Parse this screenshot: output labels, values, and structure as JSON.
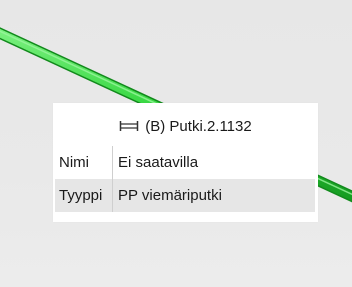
{
  "tooltip": {
    "icon": "pipe-icon",
    "title": "(B) Putki.2.1132",
    "rows": [
      {
        "key": "Nimi",
        "value": "Ei saatavilla"
      },
      {
        "key": "Tyyppi",
        "value": "PP viemäriputki"
      }
    ]
  },
  "colors": {
    "pipe_green": "#2fd43a",
    "background": "#eaeaea",
    "alt_row": "#e6e6e6"
  }
}
